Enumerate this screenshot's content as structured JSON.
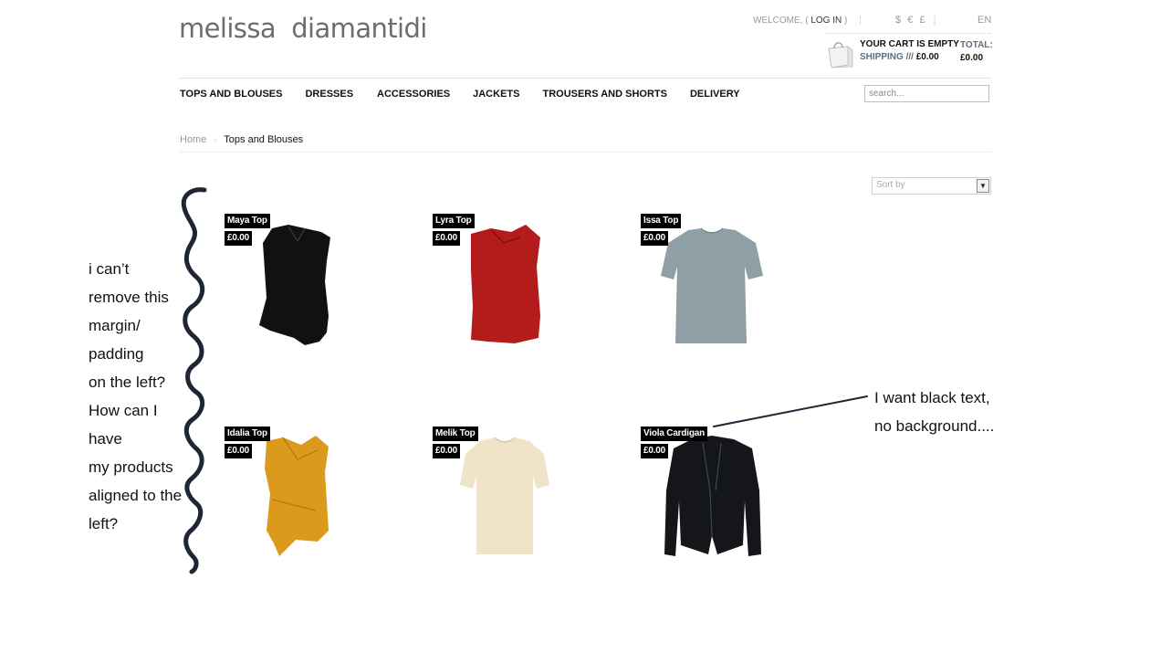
{
  "header": {
    "logo": "melissa  diamantidi",
    "welcome_prefix": "WELCOME, (",
    "login": "LOG IN",
    "welcome_suffix": ")",
    "currencies": [
      "$",
      "€",
      "£"
    ],
    "language": "EN",
    "cart_status": "YOUR CART IS EMPTY",
    "shipping_label": "SHIPPING ///",
    "shipping_value": "£0.00",
    "total_label": "TOTAL:",
    "total_value": "£0.00"
  },
  "nav": {
    "items": [
      {
        "label": "TOPS AND BLOUSES"
      },
      {
        "label": "DRESSES"
      },
      {
        "label": "ACCESSORIES"
      },
      {
        "label": "JACKETS"
      },
      {
        "label": "TROUSERS AND SHORTS"
      },
      {
        "label": "DELIVERY"
      }
    ],
    "search_placeholder": "search..."
  },
  "breadcrumb": {
    "home": "Home",
    "current": "Tops and Blouses"
  },
  "sort": {
    "label": "Sort by"
  },
  "products": [
    {
      "name": "Maya Top",
      "price": "£0.00",
      "color": "#111111"
    },
    {
      "name": "Lyra Top",
      "price": "£0.00",
      "color": "#b41c1c"
    },
    {
      "name": "Issa Top",
      "price": "£0.00",
      "color": "#8ea0a6"
    },
    {
      "name": "Idalia Top",
      "price": "£0.00",
      "color": "#dc9a1c"
    },
    {
      "name": "Melik Top",
      "price": "£0.00",
      "color": "#efe3c8"
    },
    {
      "name": "Viola Cardigan",
      "price": "£0.00",
      "color": "#15161a"
    }
  ],
  "annotations": {
    "left_lines": [
      "i can’t",
      "remove this",
      "margin/",
      "padding",
      "on the left?",
      "How can I",
      "have",
      "my products",
      "aligned to the",
      "left?"
    ],
    "right_lines": [
      "I want black text,",
      "no background...."
    ],
    "ink_color": "#1e2535"
  }
}
